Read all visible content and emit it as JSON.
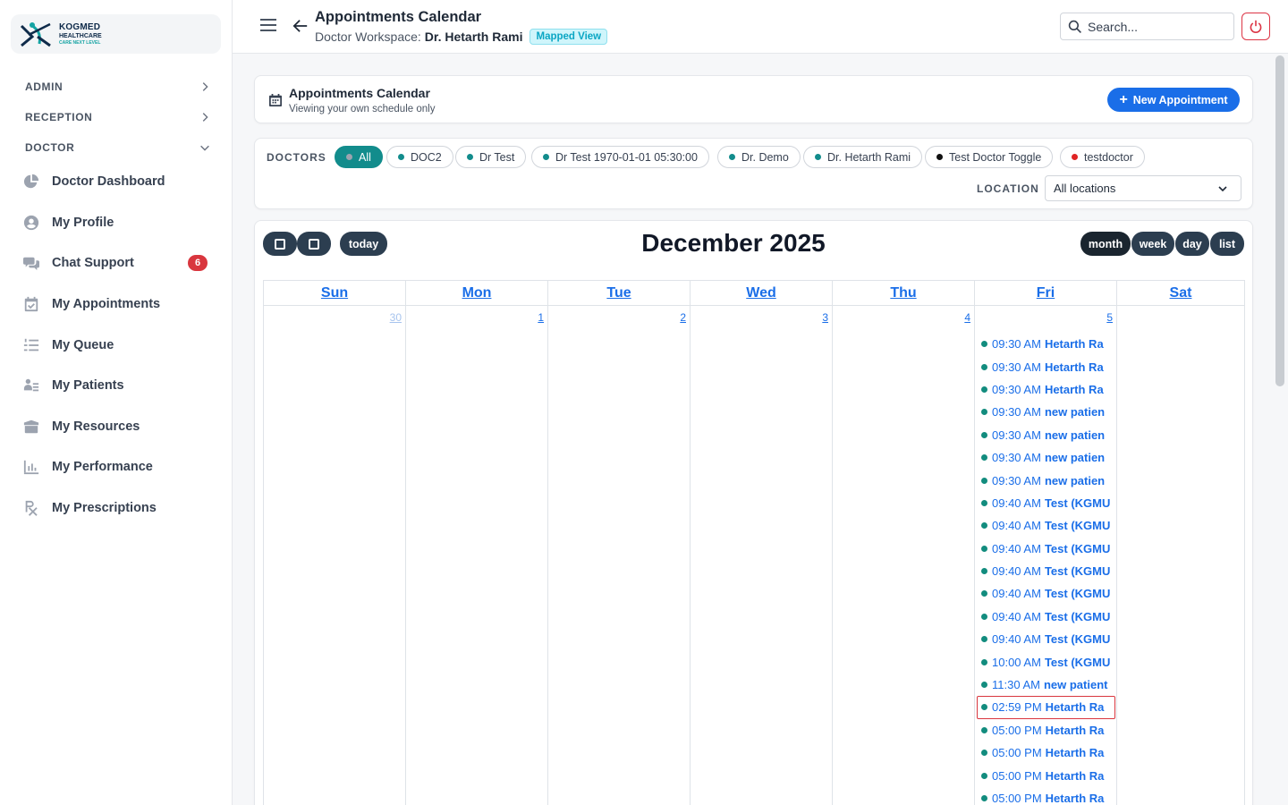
{
  "brand": {
    "line1": "KOGMED",
    "line2": "HEALTHCARE",
    "tagline": "CARE NEXT LEVEL"
  },
  "sidebar": {
    "sections": [
      {
        "label": "ADMIN",
        "state": "collapsed"
      },
      {
        "label": "RECEPTION",
        "state": "collapsed"
      },
      {
        "label": "DOCTOR",
        "state": "expanded"
      }
    ],
    "items": [
      {
        "label": "Doctor Dashboard",
        "icon": "pie-chart-icon"
      },
      {
        "label": "My Profile",
        "icon": "user-circle-icon"
      },
      {
        "label": "Chat Support",
        "icon": "chat-icon",
        "badge": "6"
      },
      {
        "label": "My Appointments",
        "icon": "calendar-check-icon"
      },
      {
        "label": "My Queue",
        "icon": "list-ordered-icon"
      },
      {
        "label": "My Patients",
        "icon": "patient-card-icon"
      },
      {
        "label": "My Resources",
        "icon": "box-icon"
      },
      {
        "label": "My Performance",
        "icon": "bar-chart-icon"
      },
      {
        "label": "My Prescriptions",
        "icon": "prescription-icon"
      }
    ]
  },
  "topbar": {
    "title": "Appointments Calendar",
    "workspace_prefix": "Doctor Workspace:",
    "doctor_name": "Dr. Hetarth Rami",
    "mapped_badge": "Mapped View",
    "search_placeholder": "Search..."
  },
  "header_card": {
    "title": "Appointments Calendar",
    "subtitle": "Viewing your own schedule only",
    "new_button": "New Appointment"
  },
  "filters": {
    "doctors_label": "DOCTORS",
    "chips": [
      {
        "label": "All",
        "color": "#9ca3af",
        "active": true
      },
      {
        "label": "DOC2",
        "color": "#128c8c"
      },
      {
        "label": "Dr Test",
        "color": "#128c8c"
      },
      {
        "label": "Dr Test 1970-01-01 05:30:00",
        "color": "#128c8c"
      },
      {
        "label": "Dr. Demo",
        "color": "#128c8c"
      },
      {
        "label": "Dr. Hetarth Rami",
        "color": "#128c8c"
      },
      {
        "label": "Test Doctor Toggle",
        "color": "#111111"
      },
      {
        "label": "testdoctor",
        "color": "#e02424"
      }
    ],
    "location_label": "LOCATION",
    "location_value": "All locations"
  },
  "calendar": {
    "title": "December 2025",
    "today_label": "today",
    "views": [
      "month",
      "week",
      "day",
      "list"
    ],
    "active_view": "month",
    "weekdays": [
      "Sun",
      "Mon",
      "Tue",
      "Wed",
      "Thu",
      "Fri",
      "Sat"
    ],
    "dates": [
      "30",
      "1",
      "2",
      "3",
      "4",
      "5",
      ""
    ],
    "events_fri": [
      {
        "time": "09:30 AM",
        "name": "Hetarth Ra"
      },
      {
        "time": "09:30 AM",
        "name": "Hetarth Ra"
      },
      {
        "time": "09:30 AM",
        "name": "Hetarth Ra"
      },
      {
        "time": "09:30 AM",
        "name": "new patien"
      },
      {
        "time": "09:30 AM",
        "name": "new patien"
      },
      {
        "time": "09:30 AM",
        "name": "new patien"
      },
      {
        "time": "09:30 AM",
        "name": "new patien"
      },
      {
        "time": "09:40 AM",
        "name": "Test (KGMU"
      },
      {
        "time": "09:40 AM",
        "name": "Test (KGMU"
      },
      {
        "time": "09:40 AM",
        "name": "Test (KGMU"
      },
      {
        "time": "09:40 AM",
        "name": "Test (KGMU"
      },
      {
        "time": "09:40 AM",
        "name": "Test (KGMU"
      },
      {
        "time": "09:40 AM",
        "name": "Test (KGMU"
      },
      {
        "time": "09:40 AM",
        "name": "Test (KGMU"
      },
      {
        "time": "10:00 AM",
        "name": "Test (KGMU"
      },
      {
        "time": "11:30 AM",
        "name": "new patient"
      },
      {
        "time": "02:59 PM",
        "name": "Hetarth Ra",
        "selected": true
      },
      {
        "time": "05:00 PM",
        "name": "Hetarth Ra"
      },
      {
        "time": "05:00 PM",
        "name": "Hetarth Ra"
      },
      {
        "time": "05:00 PM",
        "name": "Hetarth Ra"
      },
      {
        "time": "05:00 PM",
        "name": "Hetarth Ra"
      }
    ]
  }
}
